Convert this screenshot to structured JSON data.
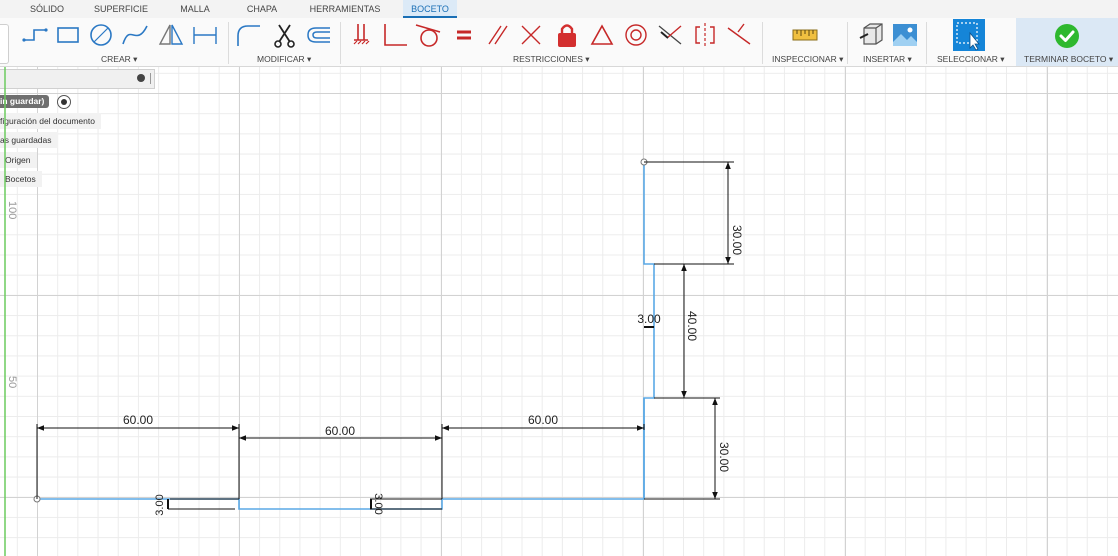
{
  "tabs": [
    "SÓLIDO",
    "SUPERFICIE",
    "MALLA",
    "CHAPA",
    "HERRAMIENTAS",
    "BOCETO"
  ],
  "active_tab": "BOCETO",
  "toolbar": {
    "groups": {
      "crear": "CREAR ▾",
      "modificar": "MODIFICAR ▾",
      "restricciones": "RESTRICCIONES ▾",
      "inspeccionar": "INSPECCIONAR ▾",
      "insertar": "INSERTAR ▾",
      "seleccionar": "SELECCIONAR ▾",
      "terminar": "TERMINAR BOCETO ▾"
    },
    "icons": {
      "crear": [
        "polyline-icon",
        "rectangle-icon",
        "circle-icon",
        "spline-icon",
        "mirror-triangle-icon",
        "dimension-icon"
      ],
      "modificar": [
        "fillet-icon",
        "trim-scissors-icon",
        "offset-icon"
      ],
      "restricciones": [
        "fix-icon",
        "perpendicular-icon",
        "tangent-icon",
        "equal-icon",
        "parallel-icon",
        "coincident-cross-icon",
        "lock-icon",
        "triangle-icon",
        "concentric-icon",
        "midpoint-icon",
        "symmetry-icon",
        "horizontal-vertical-icon"
      ],
      "inspeccionar": [
        "measure-ruler-icon"
      ],
      "insertar": [
        "insert-derive-icon",
        "insert-image-icon"
      ],
      "seleccionar": [
        "select-cursor-icon"
      ],
      "terminar": [
        "finish-check-icon"
      ]
    },
    "accent": "#1585d8",
    "finish_color": "#2eb82e"
  },
  "browser": {
    "document_label": "in guardar)",
    "items": [
      "figuración del documento",
      "as guardadas",
      "Origen",
      "Bocetos"
    ]
  },
  "canvas": {
    "ruler_labels": [
      "100",
      "50"
    ],
    "dimensions": {
      "top_width_1": "60.00",
      "top_width_2": "60.00",
      "top_width_3": "60.00",
      "thickness_1": "3.00",
      "thickness_2": "3.00",
      "thickness_3": "3.00",
      "height_upper": "30.00",
      "height_mid": "40.00",
      "height_lower": "30.00"
    },
    "sketch_color": "#5aa9e6"
  }
}
